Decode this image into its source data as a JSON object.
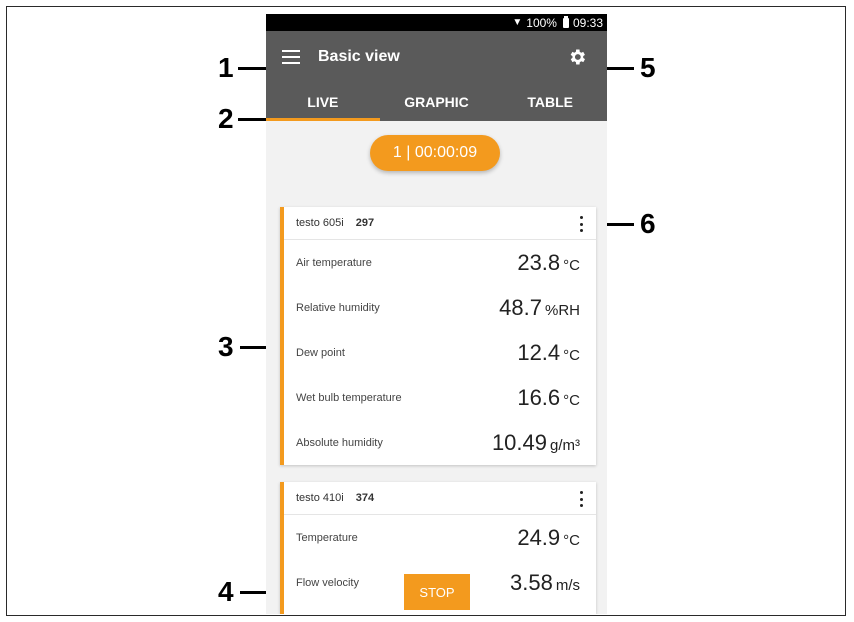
{
  "status_bar": {
    "battery": "100%",
    "time": "09:33"
  },
  "app_bar": {
    "title": "Basic view"
  },
  "tabs": [
    {
      "label": "LIVE",
      "active": true
    },
    {
      "label": "GRAPHIC",
      "active": false
    },
    {
      "label": "TABLE",
      "active": false
    }
  ],
  "timer": "1 | 00:00:09",
  "cards": [
    {
      "device": "testo 605i",
      "serial": "297",
      "rows": [
        {
          "label": "Air temperature",
          "value": "23.8",
          "unit": "°C"
        },
        {
          "label": "Relative humidity",
          "value": "48.7",
          "unit": "%RH"
        },
        {
          "label": "Dew point",
          "value": "12.4",
          "unit": "°C"
        },
        {
          "label": "Wet bulb temperature",
          "value": "16.6",
          "unit": "°C"
        },
        {
          "label": "Absolute humidity",
          "value": "10.49",
          "unit": "g/m³"
        }
      ]
    },
    {
      "device": "testo 410i",
      "serial": "374",
      "rows": [
        {
          "label": "Temperature",
          "value": "24.9",
          "unit": "°C"
        },
        {
          "label": "Flow velocity",
          "value": "3.58",
          "unit": "m/s"
        }
      ]
    }
  ],
  "stop_label": "STOP",
  "callouts": [
    "1",
    "2",
    "3",
    "4",
    "5",
    "6"
  ],
  "colors": {
    "accent": "#f39a1e",
    "appbar": "#5a5a5a"
  }
}
